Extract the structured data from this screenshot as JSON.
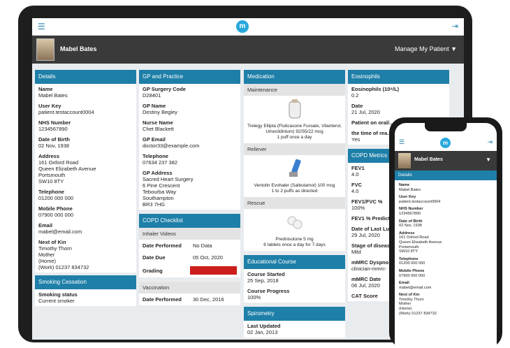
{
  "app": {
    "logo": "m",
    "hamburger_icon": "menu-icon",
    "exit_icon": "exit-icon"
  },
  "user": {
    "name": "Mabel Bates",
    "manage": "Manage My Patient ▼"
  },
  "details": {
    "header": "Details",
    "fields": [
      {
        "label": "Name",
        "value": [
          "Mabel Bates"
        ]
      },
      {
        "label": "User Key",
        "value": [
          "patient.testaccount0004"
        ]
      },
      {
        "label": "NHS Number",
        "value": [
          "1234567890"
        ]
      },
      {
        "label": "Date of Birth",
        "value": [
          "02 Nov, 1938"
        ]
      },
      {
        "label": "Address",
        "value": [
          "161 Oxford Road",
          "Queen Elizabeth Avenue",
          "Portsmouth",
          "SW10 8TY"
        ]
      },
      {
        "label": "Telephone",
        "value": [
          "01200 000 000"
        ]
      },
      {
        "label": "Mobile Phone",
        "value": [
          "07900 000 000"
        ]
      },
      {
        "label": "Email",
        "value": [
          "mabel@email.com"
        ]
      },
      {
        "label": "Next of Kin",
        "value": [
          "Timothy Thorn",
          "Mother",
          "(Home)",
          "(Work) 01237 834732"
        ]
      }
    ]
  },
  "smoking": {
    "header": "Smoking Cessation",
    "label": "Smoking status",
    "value": "Current smoker"
  },
  "gp": {
    "header": "GP and Practice",
    "fields": [
      {
        "label": "GP Surgery Code",
        "value": [
          "D28401"
        ]
      },
      {
        "label": "GP Name",
        "value": [
          "Destiny Begley"
        ]
      },
      {
        "label": "Nurse Name",
        "value": [
          "Chet Blackett"
        ]
      },
      {
        "label": "GP Email",
        "value": [
          "doctor33@example.com"
        ]
      },
      {
        "label": "Telephone",
        "value": [
          "07634 237 382"
        ]
      },
      {
        "label": "GP Address",
        "value": [
          "Sacred Heart Surgery",
          "6 Pine Crescent",
          "Tebourba Way",
          "Southampton",
          "BR3 7HG"
        ]
      }
    ]
  },
  "copd": {
    "header": "COPD Checklist",
    "sub": "Inhaler Videos",
    "performed_label": "Date Performed",
    "performed_value": "No Data",
    "due_label": "Date Due",
    "due_value": "05 Oct, 2020",
    "grading_label": "Grading"
  },
  "vaccination": {
    "sub": "Vaccination",
    "performed_label": "Date Performed",
    "performed_value": "30 Dec, 2016"
  },
  "medication": {
    "header": "Medication",
    "groups": [
      {
        "sub": "Maintenance",
        "name": "Trelegy Ellipta (Fluticasone Furoate, Vilanterol, Umeclidinium) 92/55/22 mcg",
        "dose": "1 puff once a day"
      },
      {
        "sub": "Reliever",
        "name": "Ventolin Evohaler (Salbutamol) 100 mcg",
        "dose": "1 to 2 puffs as directed"
      },
      {
        "sub": "Rescue",
        "name": "Prednisolone 5 mg",
        "dose": "6 tablets once a day for 7 days"
      }
    ]
  },
  "education": {
    "header": "Educational Course",
    "started_label": "Course Started",
    "started_value": "25 Sep, 2018",
    "progress_label": "Course Progress",
    "progress_value": "100%"
  },
  "spirometry": {
    "header": "Spirometry",
    "updated_label": "Last Updated",
    "updated_value": "02 Jan, 2013"
  },
  "eosinophils": {
    "header": "Eosinophils",
    "fields": [
      {
        "label": "Eosinophils (10⁹/L)",
        "value": "0.2"
      },
      {
        "label": "Date",
        "value": "21 Jul, 2020"
      },
      {
        "label": "Patient on oral/...",
        "value": ""
      },
      {
        "label": "the time of rea...",
        "value": "Yes"
      }
    ]
  },
  "copd_metrics": {
    "header": "COPD Metrics",
    "fields": [
      {
        "label": "FEV1",
        "value": "4.0"
      },
      {
        "label": "FVC",
        "value": "4.0"
      },
      {
        "label": "FEV1/FVC %",
        "value": "100%"
      },
      {
        "label": "FEV1 % Predict",
        "value": ""
      },
      {
        "label": "Date of Last Lu",
        "value": "29 Jul, 2020"
      },
      {
        "label": "Stage of diseas",
        "value": "Mild"
      },
      {
        "label": "mMRC Dyspno",
        "value": "clinician-mmrc-"
      },
      {
        "label": "mMRC Date",
        "value": "06 Jul, 2020"
      },
      {
        "label": "CAT Score",
        "value": ""
      }
    ]
  },
  "phone": {
    "details_header": "Details"
  }
}
